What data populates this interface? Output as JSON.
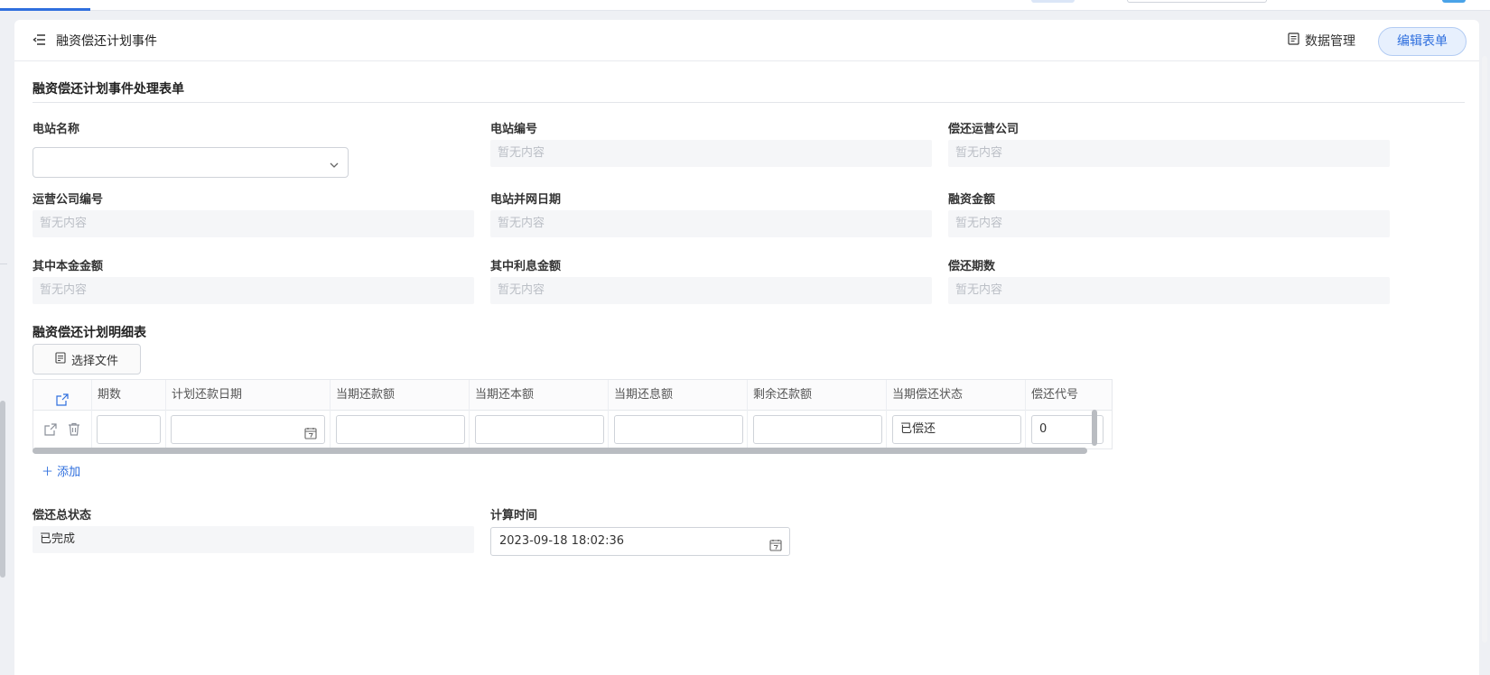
{
  "header": {
    "title": "融资偿还计划事件",
    "data_mgmt_label": "数据管理",
    "edit_label": "编辑表单"
  },
  "form": {
    "title": "融资偿还计划事件处理表单",
    "placeholder": "暂无内容",
    "fields": {
      "station_name": {
        "label": "电站名称",
        "value": ""
      },
      "station_code": {
        "label": "电站编号"
      },
      "repay_company": {
        "label": "偿还运营公司"
      },
      "company_code": {
        "label": "运营公司编号"
      },
      "grid_date": {
        "label": "电站并网日期"
      },
      "finance_amount": {
        "label": "融资金额"
      },
      "principal_amount": {
        "label": "其中本金金额"
      },
      "interest_amount": {
        "label": "其中利息金额"
      },
      "repay_periods": {
        "label": "偿还期数"
      }
    }
  },
  "detail": {
    "title": "融资偿还计划明细表",
    "file_button": "选择文件",
    "columns": [
      "期数",
      "计划还款日期",
      "当期还款额",
      "当期还本额",
      "当期还息额",
      "剩余还款额",
      "当期偿还状态",
      "偿还代号"
    ],
    "rows": [
      {
        "period": "",
        "plan_date": "",
        "repay": "",
        "principal": "",
        "interest": "",
        "remaining": "",
        "status": "已偿还",
        "code": "0"
      }
    ],
    "add_label": "添加"
  },
  "summary": {
    "total_status_label": "偿还总状态",
    "total_status_value": "已完成",
    "calc_time_label": "计算时间",
    "calc_time_value": "2023-09-18 18:02:36"
  },
  "colors": {
    "accent": "#2f6fde",
    "readonly_bg": "#f5f6f8",
    "placeholder": "#bbbfc6"
  }
}
